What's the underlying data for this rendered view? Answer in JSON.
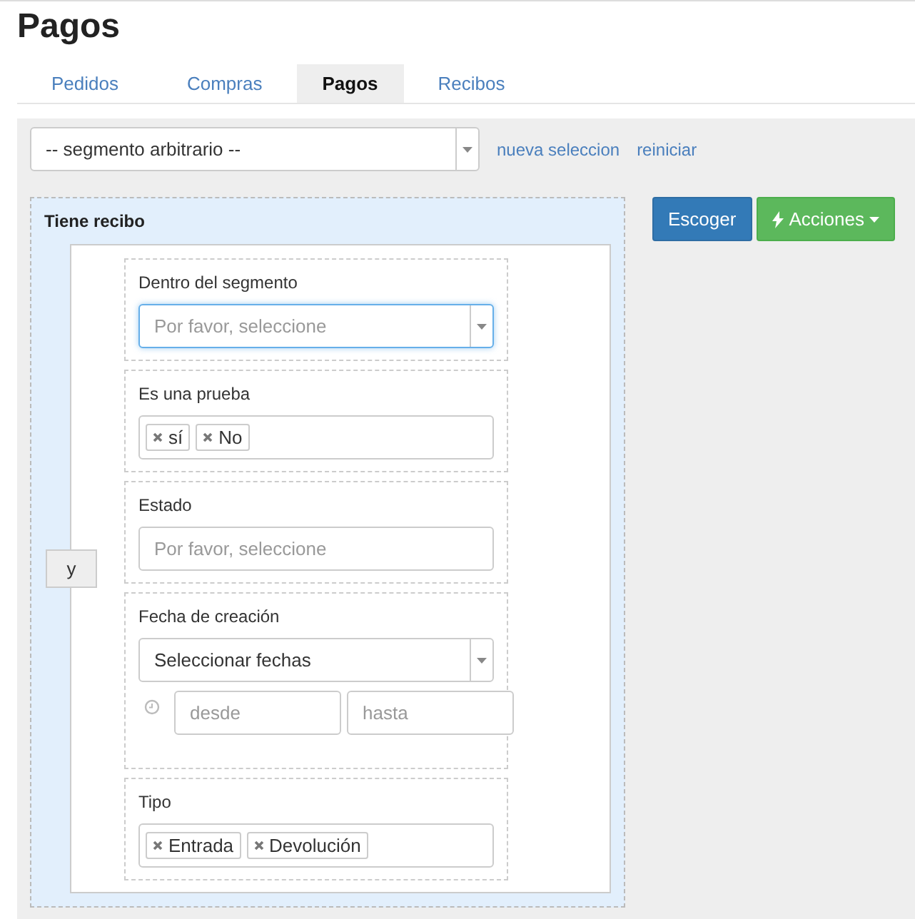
{
  "title": "Pagos",
  "tabs": [
    {
      "label": "Pedidos",
      "selected": false
    },
    {
      "label": "Compras",
      "selected": false
    },
    {
      "label": "Pagos",
      "selected": true
    },
    {
      "label": "Recibos",
      "selected": false
    }
  ],
  "segment": {
    "value": "-- segmento arbitrario --",
    "links": [
      "nueva seleccion",
      "reiniciar"
    ]
  },
  "buttons": [
    {
      "label": "Escoger",
      "kind": "primary"
    },
    {
      "label": "Acciones",
      "kind": "actions"
    }
  ],
  "group": {
    "title": "Tiene recibo",
    "operator": "y",
    "filters": [
      {
        "label": "Dentro del segmento",
        "kind": "select",
        "placeholder": "Por favor, seleccione",
        "focused": true
      },
      {
        "label": "Es una prueba",
        "kind": "tags",
        "tags": [
          "sí",
          "No"
        ]
      },
      {
        "label": "Estado",
        "kind": "input",
        "placeholder": "Por favor, seleccione"
      },
      {
        "label": "Fecha de creación",
        "kind": "daterange",
        "value": "Seleccionar fechas",
        "from": {
          "placeholder": "desde"
        },
        "to": {
          "placeholder": "hasta"
        }
      },
      {
        "label": "Tipo",
        "kind": "tags",
        "tags": [
          "Entrada",
          "Devolución"
        ]
      }
    ]
  }
}
